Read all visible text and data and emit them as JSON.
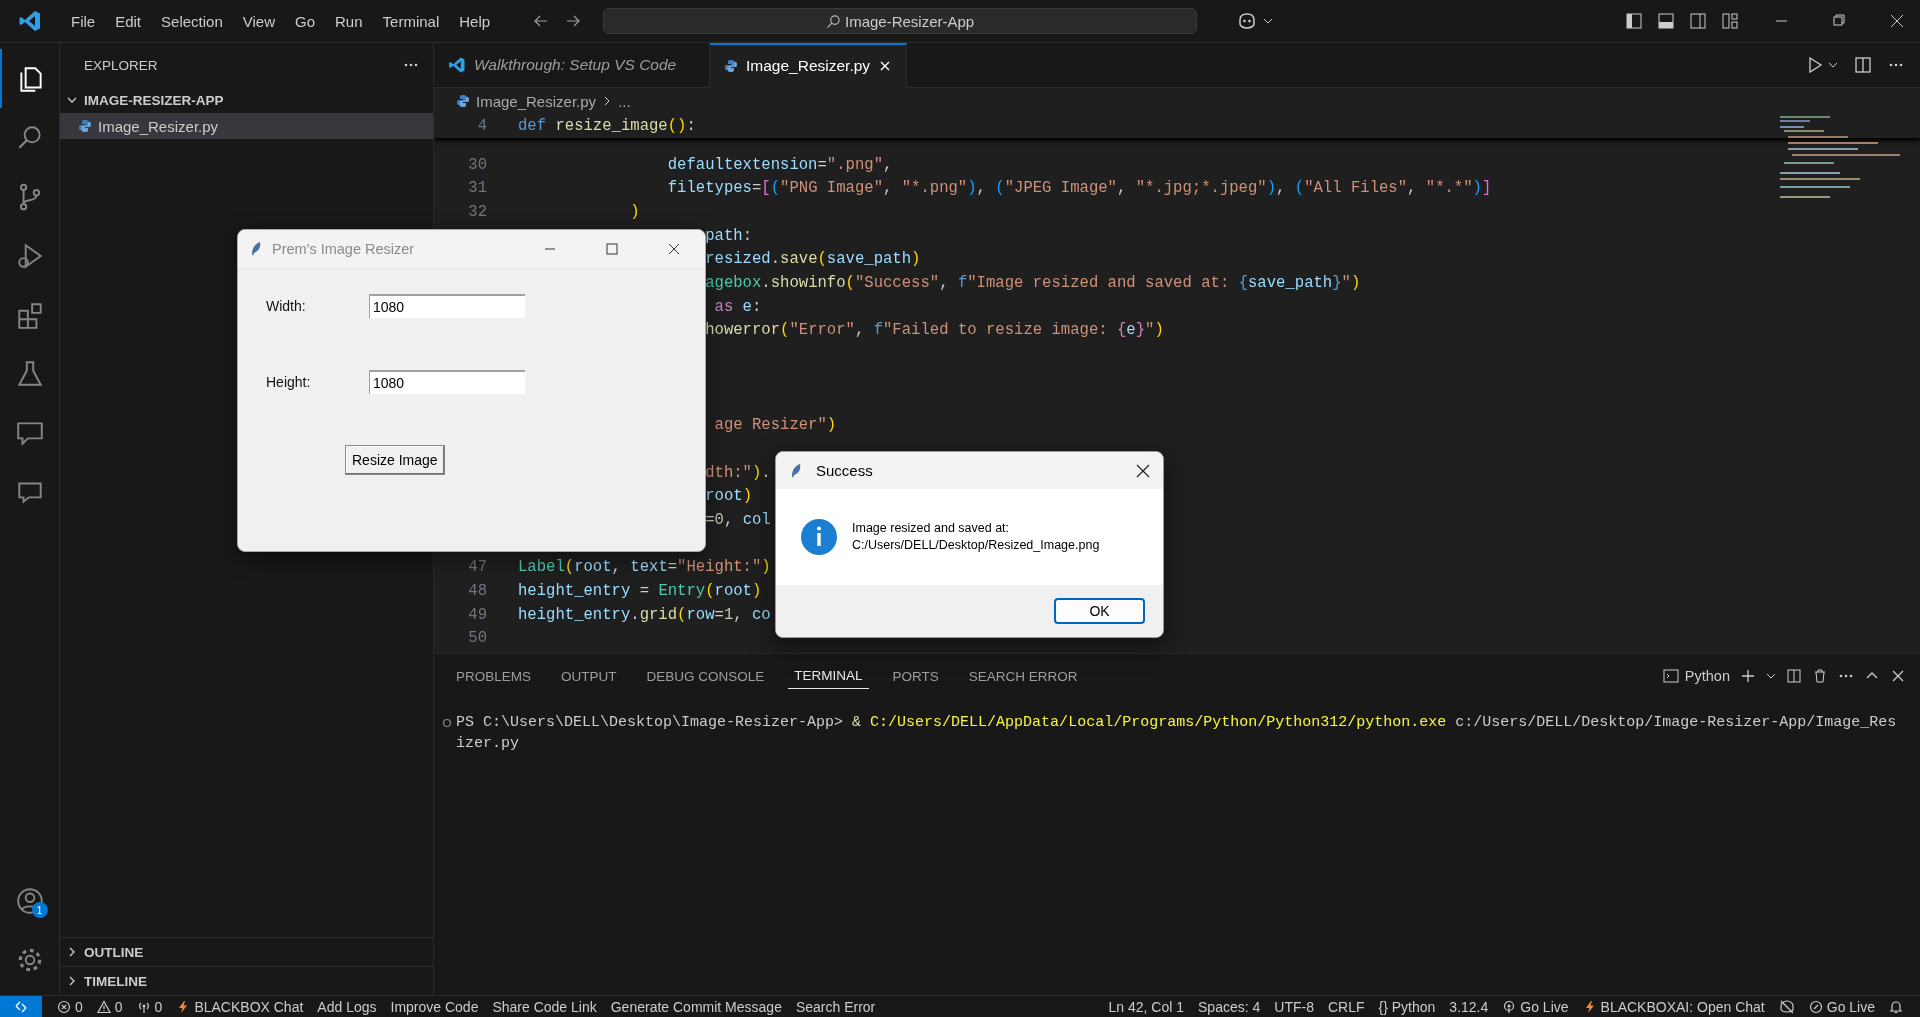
{
  "title_bar": {
    "menu": [
      "File",
      "Edit",
      "Selection",
      "View",
      "Go",
      "Run",
      "Terminal",
      "Help"
    ],
    "search": "Image-Resizer-App"
  },
  "activity_bar": {
    "items": [
      {
        "kind": "files",
        "selected": true
      },
      {
        "kind": "search",
        "selected": false
      },
      {
        "kind": "source-control",
        "selected": false
      },
      {
        "kind": "run-debug",
        "selected": false
      },
      {
        "kind": "extensions",
        "selected": false
      },
      {
        "kind": "testing",
        "selected": false
      },
      {
        "kind": "chat",
        "selected": false
      },
      {
        "kind": "comments",
        "selected": false
      }
    ],
    "account_badge": "1"
  },
  "sidebar": {
    "title": "EXPLORER",
    "folder": {
      "name": "IMAGE-RESIZER-APP",
      "expanded": true,
      "files": [
        {
          "name": "Image_Resizer.py",
          "selected": true
        }
      ]
    },
    "sections": [
      {
        "name": "OUTLINE",
        "expanded": false
      },
      {
        "name": "TIMELINE",
        "expanded": false
      }
    ]
  },
  "editor": {
    "tabs": [
      {
        "label": "Walkthrough: Setup VS Code",
        "kind": "walkthrough",
        "selected": false
      },
      {
        "label": "Image_Resizer.py",
        "kind": "python",
        "selected": true
      }
    ],
    "breadcrumb": [
      "Image_Resizer.py",
      "..."
    ],
    "sticky": {
      "number": "4",
      "tokens": [
        {
          "kind": "kw",
          "text": "def "
        },
        {
          "kind": "fn",
          "text": "resize_image"
        },
        {
          "kind": "b1",
          "text": "()"
        },
        {
          "kind": "p",
          "text": ":"
        }
      ]
    },
    "blocks": [
      [
        {
          "number": "30",
          "tokens": [
            {
              "kind": "var",
              "text": "                defaultextension"
            },
            {
              "kind": "p",
              "text": "="
            },
            {
              "kind": "str",
              "text": "\".png\""
            },
            {
              "kind": "p",
              "text": ","
            }
          ]
        },
        {
          "number": "31",
          "tokens": [
            {
              "kind": "var",
              "text": "                filetypes"
            },
            {
              "kind": "p",
              "text": "="
            },
            {
              "kind": "b2",
              "text": "["
            },
            {
              "kind": "b3",
              "text": "("
            },
            {
              "kind": "str",
              "text": "\"PNG Image\""
            },
            {
              "kind": "p",
              "text": ", "
            },
            {
              "kind": "str",
              "text": "\"*.png\""
            },
            {
              "kind": "b3",
              "text": ")"
            },
            {
              "kind": "p",
              "text": ", "
            },
            {
              "kind": "b3",
              "text": "("
            },
            {
              "kind": "str",
              "text": "\"JPEG Image\""
            },
            {
              "kind": "p",
              "text": ", "
            },
            {
              "kind": "str",
              "text": "\"*.jpg;*.jpeg\""
            },
            {
              "kind": "b3",
              "text": ")"
            },
            {
              "kind": "p",
              "text": ", "
            },
            {
              "kind": "b3",
              "text": "("
            },
            {
              "kind": "str",
              "text": "\"All Files\""
            },
            {
              "kind": "p",
              "text": ", "
            },
            {
              "kind": "str",
              "text": "\"*.*\""
            },
            {
              "kind": "b3",
              "text": ")"
            },
            {
              "kind": "b2",
              "text": "]"
            }
          ]
        },
        {
          "number": "32",
          "tokens": [
            {
              "kind": "b1",
              "text": "            )"
            }
          ]
        },
        {
          "tokens": [
            {
              "kind": "var",
              "text": "                    path"
            },
            {
              "kind": "p",
              "text": ":"
            }
          ]
        },
        {
          "tokens": [
            {
              "kind": "var",
              "text": "                    resized"
            },
            {
              "kind": "p",
              "text": "."
            },
            {
              "kind": "fn",
              "text": "save"
            },
            {
              "kind": "b1",
              "text": "("
            },
            {
              "kind": "var",
              "text": "save_path"
            },
            {
              "kind": "b1",
              "text": ")"
            }
          ]
        },
        {
          "tokens": [
            {
              "kind": "cls",
              "text": "                    agebox"
            },
            {
              "kind": "p",
              "text": "."
            },
            {
              "kind": "fn",
              "text": "showinfo"
            },
            {
              "kind": "b1",
              "text": "("
            },
            {
              "kind": "str",
              "text": "\"Success\""
            },
            {
              "kind": "p",
              "text": ", "
            },
            {
              "kind": "kw",
              "text": "f"
            },
            {
              "kind": "str",
              "text": "\"Image resized and saved at: "
            },
            {
              "kind": "kw",
              "text": "{"
            },
            {
              "kind": "var",
              "text": "save_path"
            },
            {
              "kind": "kw",
              "text": "}"
            },
            {
              "kind": "str",
              "text": "\""
            },
            {
              "kind": "b1",
              "text": ")"
            }
          ]
        },
        {
          "tokens": [
            {
              "kind": "ctl",
              "text": "                     as"
            },
            {
              "kind": "var",
              "text": " e"
            },
            {
              "kind": "p",
              "text": ":"
            }
          ]
        },
        {
          "tokens": [
            {
              "kind": "fn",
              "text": "                    howerror"
            },
            {
              "kind": "b1",
              "text": "("
            },
            {
              "kind": "str",
              "text": "\"Error\""
            },
            {
              "kind": "p",
              "text": ", "
            },
            {
              "kind": "kw",
              "text": "f"
            },
            {
              "kind": "str",
              "text": "\"Failed to resize image: "
            },
            {
              "kind": "ctl",
              "text": "{"
            },
            {
              "kind": "var",
              "text": "e"
            },
            {
              "kind": "ctl",
              "text": "}"
            },
            {
              "kind": "str",
              "text": "\""
            },
            {
              "kind": "b1",
              "text": ")"
            }
          ]
        }
      ],
      [
        {
          "tokens": [
            {
              "kind": "str",
              "text": "                     age Resizer\""
            },
            {
              "kind": "b1",
              "text": ")"
            }
          ]
        }
      ],
      [
        {
          "tokens": [
            {
              "kind": "str",
              "text": "                    dth:\""
            },
            {
              "kind": "b1",
              "text": ")"
            },
            {
              "kind": "p",
              "text": "."
            }
          ]
        },
        {
          "tokens": [
            {
              "kind": "var",
              "text": "                    root"
            },
            {
              "kind": "b1",
              "text": ")"
            }
          ]
        },
        {
          "tokens": [
            {
              "kind": "p",
              "text": "                    ="
            },
            {
              "kind": "num",
              "text": "0"
            },
            {
              "kind": "p",
              "text": ", "
            },
            {
              "kind": "var",
              "text": "col"
            }
          ]
        }
      ],
      [
        {
          "number": "47",
          "tokens": [
            {
              "kind": "cls",
              "text": "Label"
            },
            {
              "kind": "b1",
              "text": "("
            },
            {
              "kind": "var",
              "text": "root"
            },
            {
              "kind": "p",
              "text": ", "
            },
            {
              "kind": "var",
              "text": "text"
            },
            {
              "kind": "p",
              "text": "="
            },
            {
              "kind": "str",
              "text": "\"Height:\""
            },
            {
              "kind": "b1",
              "text": ")"
            }
          ]
        },
        {
          "number": "48",
          "tokens": [
            {
              "kind": "var",
              "text": "height_entry"
            },
            {
              "kind": "p",
              "text": " = "
            },
            {
              "kind": "cls",
              "text": "Entry"
            },
            {
              "kind": "b1",
              "text": "("
            },
            {
              "kind": "var",
              "text": "root"
            },
            {
              "kind": "b1",
              "text": ")"
            }
          ]
        },
        {
          "number": "49",
          "tokens": [
            {
              "kind": "var",
              "text": "height_entry"
            },
            {
              "kind": "p",
              "text": "."
            },
            {
              "kind": "fn",
              "text": "grid"
            },
            {
              "kind": "b1",
              "text": "("
            },
            {
              "kind": "var",
              "text": "row"
            },
            {
              "kind": "p",
              "text": "="
            },
            {
              "kind": "num",
              "text": "1"
            },
            {
              "kind": "p",
              "text": ", "
            },
            {
              "kind": "var",
              "text": "co"
            }
          ]
        },
        {
          "number": "50"
        }
      ]
    ]
  },
  "panel": {
    "tabs": [
      {
        "label": "PROBLEMS",
        "selected": false
      },
      {
        "label": "OUTPUT",
        "selected": false
      },
      {
        "label": "DEBUG CONSOLE",
        "selected": false
      },
      {
        "label": "TERMINAL",
        "selected": true
      },
      {
        "label": "PORTS",
        "selected": false
      },
      {
        "label": "SEARCH ERROR",
        "selected": false
      }
    ],
    "terminal_profile": "Python",
    "terminal_lines": [
      [
        {
          "kind": "p",
          "text": "PS C:\\Users\\DELL\\Desktop\\Image-Resizer-App> "
        },
        {
          "kind": "fn",
          "text": "& "
        },
        {
          "kind": "y",
          "text": "C:/Users/DELL/AppData/Local/Programs/Python/Python312/python.exe"
        },
        {
          "kind": "p",
          "text": " c:/Users/DELL/Desktop/Image-Resizer-App/Image_Res"
        }
      ],
      [
        {
          "kind": "p",
          "text": "izer.py"
        }
      ]
    ]
  },
  "status_bar": {
    "left": [
      {
        "kind": "errors",
        "text": "0"
      },
      {
        "kind": "warnings",
        "text": "0"
      },
      {
        "kind": "ports",
        "text": "0"
      },
      {
        "kind": "bolt",
        "text": "BLACKBOX Chat"
      },
      {
        "kind": "text",
        "text": "Add Logs"
      },
      {
        "kind": "text",
        "text": "Improve Code"
      },
      {
        "kind": "text",
        "text": "Share Code Link"
      },
      {
        "kind": "text",
        "text": "Generate Commit Message"
      },
      {
        "kind": "text",
        "text": "Search Error"
      }
    ],
    "right": [
      {
        "kind": "text",
        "text": "Ln 42, Col 1"
      },
      {
        "kind": "text",
        "text": "Spaces: 4"
      },
      {
        "kind": "text",
        "text": "UTF-8"
      },
      {
        "kind": "text",
        "text": "CRLF"
      },
      {
        "kind": "text",
        "text": "{} Python"
      },
      {
        "kind": "text",
        "text": "3.12.4"
      },
      {
        "kind": "radio",
        "text": "Go Live"
      },
      {
        "kind": "bolt",
        "text": "BLACKBOXAI: Open Chat"
      },
      {
        "kind": "copilot"
      },
      {
        "kind": "circle",
        "text": "Go Live"
      },
      {
        "kind": "bell"
      }
    ]
  },
  "app_window": {
    "title": "Prem's Image Resizer",
    "fields": [
      {
        "label": "Width:",
        "value": "1080"
      },
      {
        "label": "Height:",
        "value": "1080"
      }
    ],
    "button": "Resize Image"
  },
  "message_box": {
    "title": "Success",
    "message": "Image resized and saved at:\nC:/Users/DELL/Desktop/Resized_Image.png",
    "button": "OK"
  }
}
